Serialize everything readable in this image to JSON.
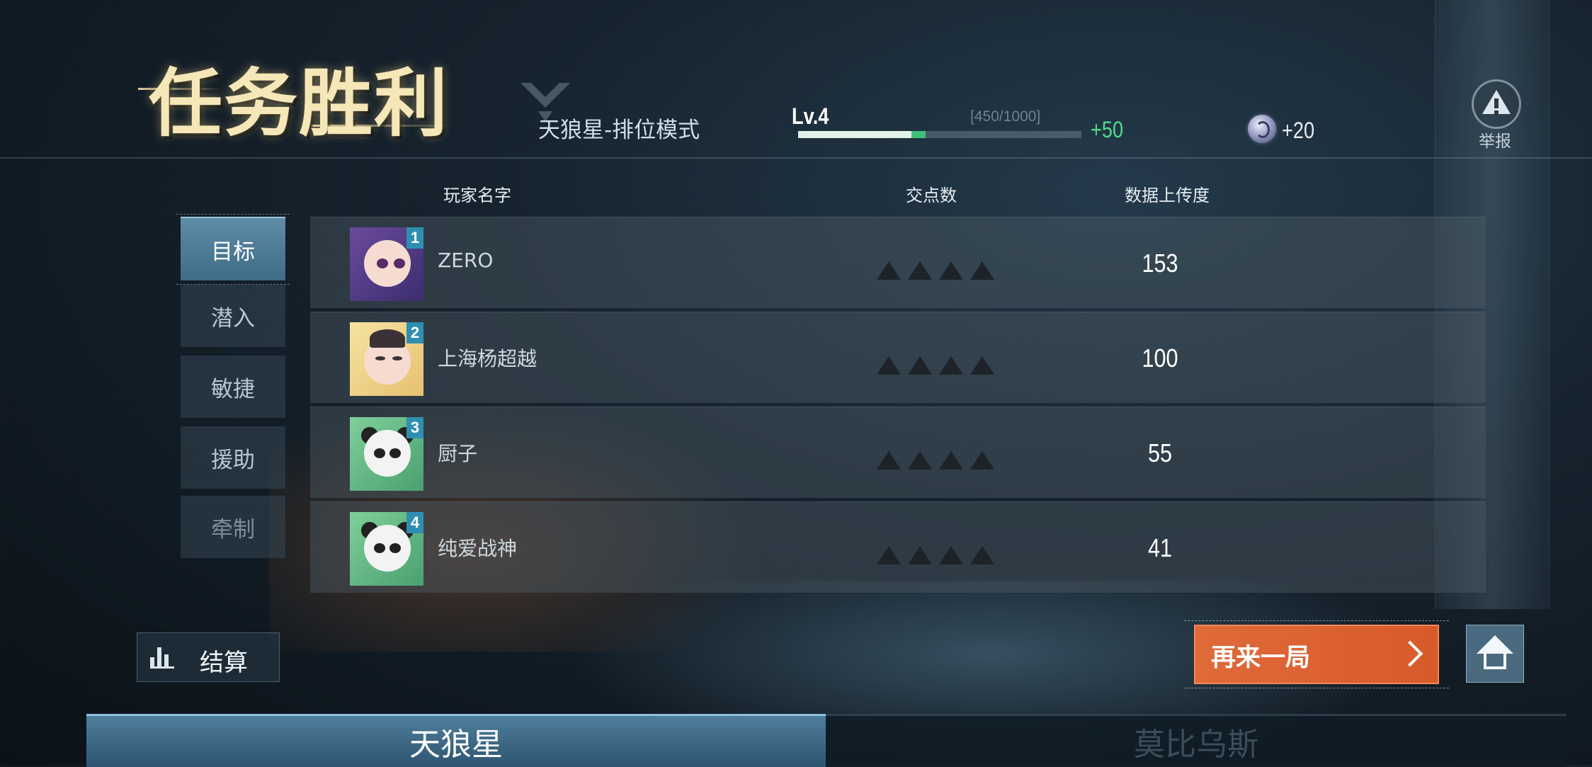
{
  "header": {
    "title": "任务胜利",
    "mode": "天狼星-排位模式",
    "level": "Lv.4",
    "exp_text": "[450/1000]",
    "exp_progress": 0.4,
    "exp_gain_fraction": 0.05,
    "exp_gain": "+50",
    "currency_gain": "+20",
    "report_label": "举报"
  },
  "table": {
    "columns": [
      "玩家名字",
      "交点数",
      "数据上传度"
    ],
    "rows": [
      {
        "rank": "1",
        "name": "ZERO",
        "score": "153",
        "avatar": "purple-hair-girl-avatar"
      },
      {
        "rank": "2",
        "name": "上海杨超越",
        "score": "100",
        "avatar": "dark-hair-boy-avatar"
      },
      {
        "rank": "3",
        "name": "厨子",
        "score": "55",
        "avatar": "panda-avatar"
      },
      {
        "rank": "4",
        "name": "纯爱战神",
        "score": "41",
        "avatar": "panda-avatar"
      }
    ]
  },
  "tabs": [
    {
      "label": "目标",
      "active": true
    },
    {
      "label": "潜入",
      "active": false
    },
    {
      "label": "敏捷",
      "active": false
    },
    {
      "label": "援助",
      "active": false
    },
    {
      "label": "牵制",
      "active": false
    }
  ],
  "buttons": {
    "settle": "结算",
    "play_again": "再来一局"
  },
  "teams": [
    "天狼星",
    "莫比乌斯"
  ],
  "colors": {
    "accent_orange": "#e06a3a",
    "exp_gain_green": "#4fdc8a",
    "active_tab": "#4f7e9c",
    "rank_badge": "#2f8fb0"
  }
}
